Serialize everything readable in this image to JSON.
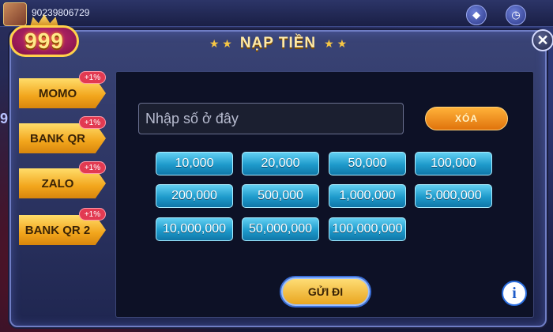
{
  "header": {
    "user_id": "90239806729",
    "logo_text": "999"
  },
  "modal": {
    "title": "NẠP TIỀN",
    "close_symbol": "✕"
  },
  "tabs": [
    {
      "label": "MOMO",
      "bonus": "+1%"
    },
    {
      "label": "BANK QR",
      "bonus": "+1%"
    },
    {
      "label": "ZALO",
      "bonus": "+1%"
    },
    {
      "label": "BANK QR 2",
      "bonus": "+1%"
    }
  ],
  "form": {
    "placeholder": "Nhập số ở đây",
    "value": "",
    "clear_label": "XÓA",
    "submit_label": "GỬI ĐI",
    "info_symbol": "i"
  },
  "amounts": [
    "10,000",
    "20,000",
    "50,000",
    "100,000",
    "200,000",
    "500,000",
    "1,000,000",
    "5,000,000",
    "10,000,000",
    "50,000,000",
    "100,000,000"
  ],
  "colors": {
    "tab_gold": "#f2a51c",
    "amount_blue": "#1e9acb",
    "clear_orange": "#e0730c",
    "badge_red": "#e23a52"
  },
  "icons": {
    "diamond": "diamond-icon",
    "clock": "clock-icon",
    "close": "close-icon",
    "info": "info-icon",
    "star": "star-icon",
    "crown": "crown-icon"
  }
}
